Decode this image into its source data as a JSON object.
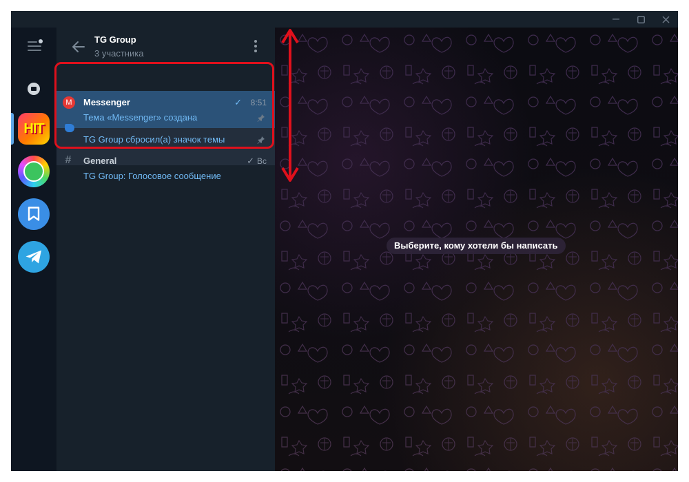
{
  "window": {
    "controls": [
      "minimize",
      "maximize",
      "close"
    ]
  },
  "folders": {
    "icons": [
      "menu-icon",
      "archive-icon",
      "hit-sticker",
      "smiley-avatar",
      "bookmark-icon",
      "telegram-icon"
    ],
    "hit_label": "HIT"
  },
  "header": {
    "title": "TG Group",
    "subtitle": "3 участника"
  },
  "topics": [
    {
      "icon_letter": "M",
      "icon_color": "#e53935",
      "name": "Messenger",
      "time": "8:51",
      "read": true,
      "last_message": "Тема «Messenger» создана",
      "pinned": true
    },
    {
      "icon_letter": "",
      "icon_color": "#2f7dd6",
      "name": "",
      "time": "",
      "last_message": "TG Group сбросил(а) значок темы",
      "pinned": true
    },
    {
      "icon_letter": "#",
      "icon_color": "#6e7b88",
      "name": "General",
      "time": "Вс",
      "read": true,
      "last_message": "TG Group: Голосовое сообщение",
      "pinned": false
    }
  ],
  "chat": {
    "empty_state": "Выберите, кому хотели бы написать"
  },
  "colors": {
    "accent": "#5fa8e8",
    "link": "#71baf5",
    "annotation": "#e0101c"
  }
}
